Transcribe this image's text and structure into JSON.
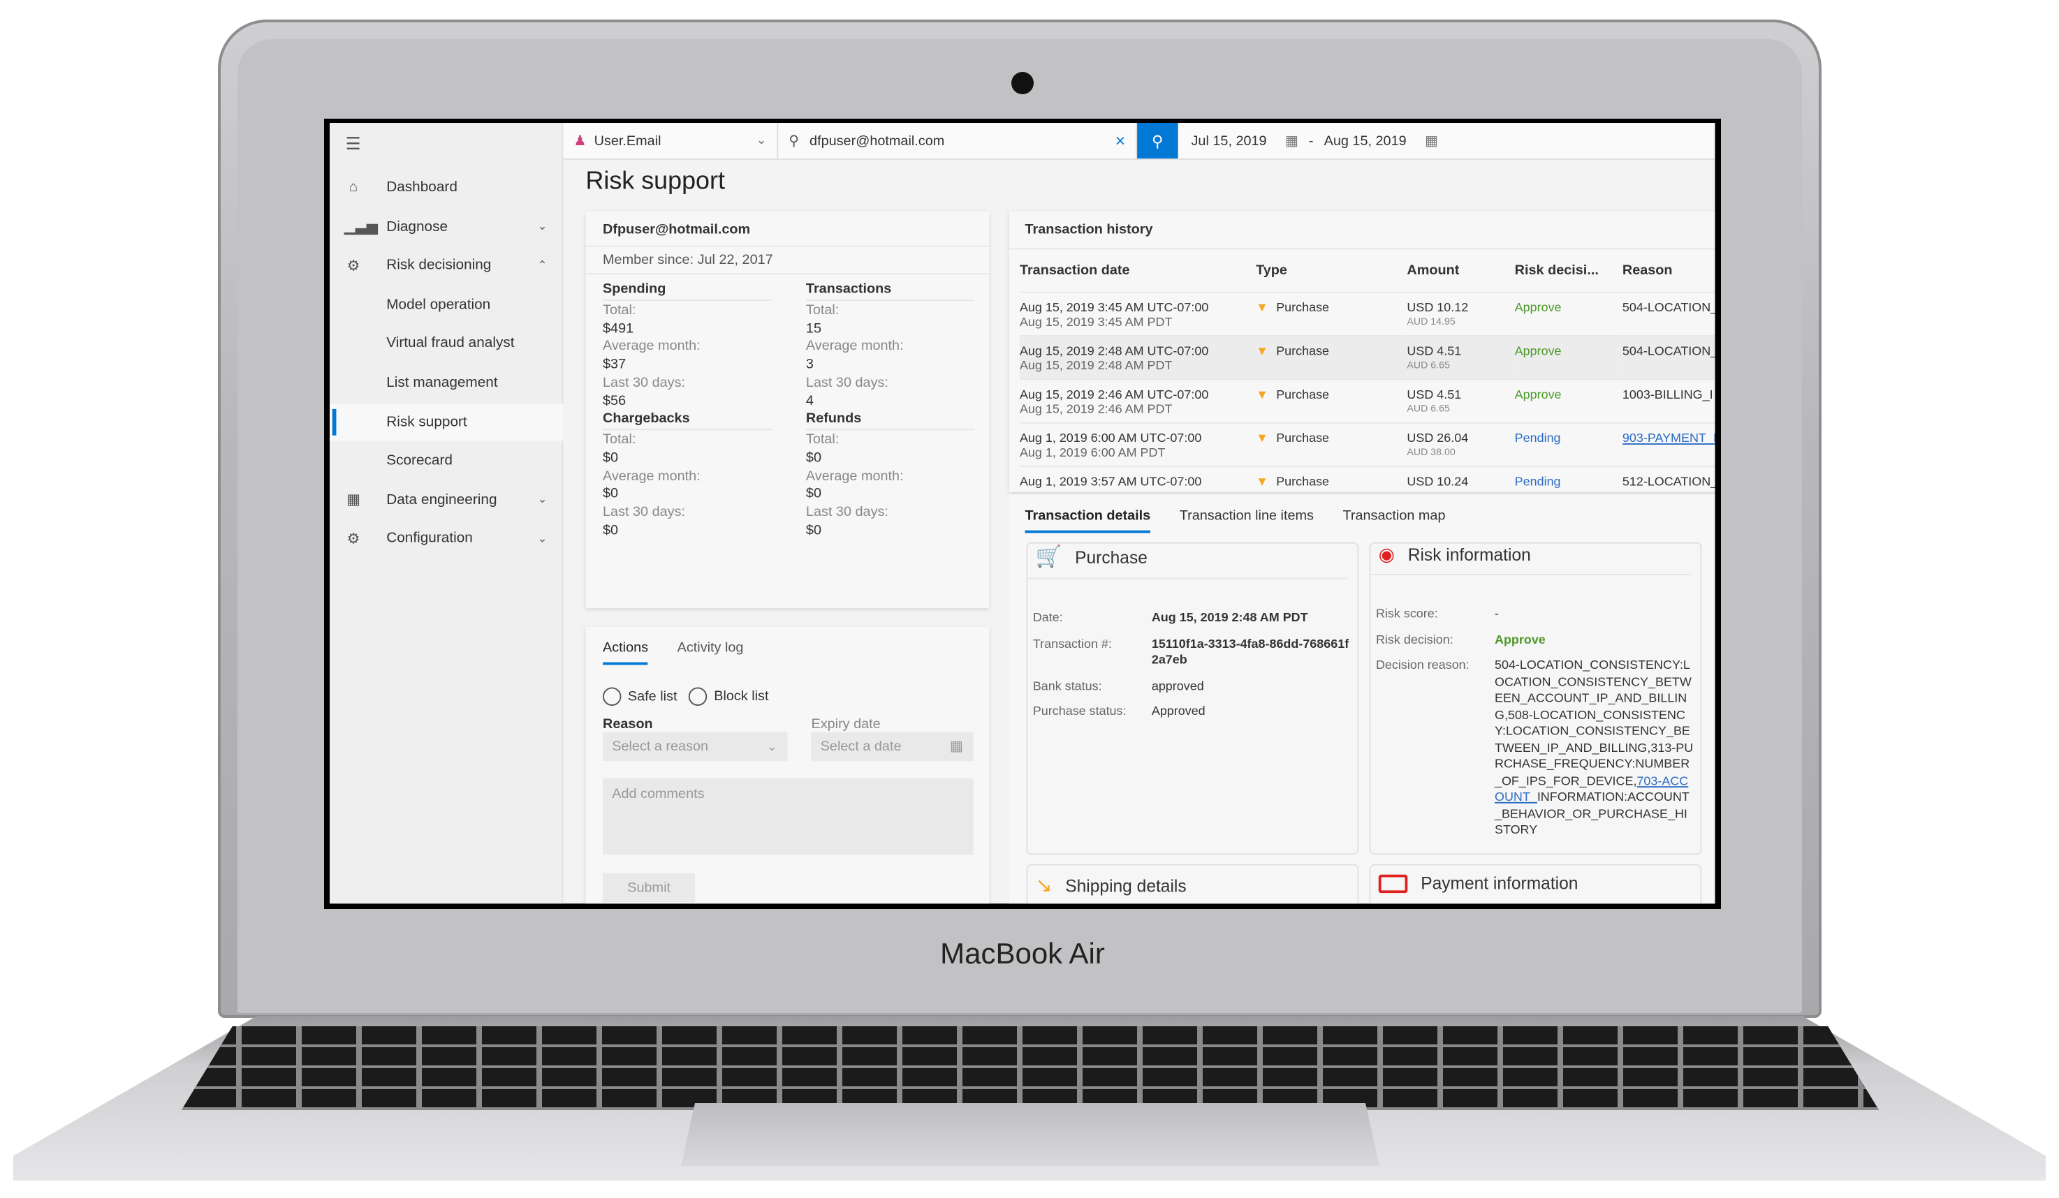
{
  "device": {
    "brand": "MacBook Air"
  },
  "sidebar": {
    "menu_icon": "hamburger-icon",
    "items": [
      {
        "label": "Dashboard",
        "icon": "home-icon"
      },
      {
        "label": "Diagnose",
        "icon": "chart-icon",
        "chevron": "down"
      },
      {
        "label": "Risk decisioning",
        "icon": "gear-flow-icon",
        "chevron": "up"
      },
      {
        "label": "Model operation"
      },
      {
        "label": "Virtual fraud analyst"
      },
      {
        "label": "List management"
      },
      {
        "label": "Risk support",
        "selected": true
      },
      {
        "label": "Scorecard"
      },
      {
        "label": "Data engineering",
        "icon": "table-icon",
        "chevron": "down"
      },
      {
        "label": "Configuration",
        "icon": "settings-icon",
        "chevron": "down"
      }
    ]
  },
  "topbar": {
    "field_select": "User.Email",
    "search_value": "dfpuser@hotmail.com",
    "date_from": "Jul 15, 2019",
    "date_sep": "-",
    "date_to": "Aug 15, 2019"
  },
  "page": {
    "title": "Risk support"
  },
  "profile": {
    "email": "Dfpuser@hotmail.com",
    "member_since": "Member since: Jul 22, 2017",
    "groups": [
      {
        "title": "Spending",
        "rows": [
          [
            "Total:",
            "$491"
          ],
          [
            "Average month:",
            "$37"
          ],
          [
            "Last 30 days:",
            "$56"
          ]
        ]
      },
      {
        "title": "Transactions",
        "rows": [
          [
            "Total:",
            "15"
          ],
          [
            "Average month:",
            "3"
          ],
          [
            "Last 30 days:",
            "4"
          ]
        ]
      },
      {
        "title": "Chargebacks",
        "rows": [
          [
            "Total:",
            "$0"
          ],
          [
            "Average month:",
            "$0"
          ],
          [
            "Last 30 days:",
            "$0"
          ]
        ]
      },
      {
        "title": "Refunds",
        "rows": [
          [
            "Total:",
            "$0"
          ],
          [
            "Average month:",
            "$0"
          ],
          [
            "Last 30 days:",
            "$0"
          ]
        ]
      }
    ]
  },
  "actions": {
    "tabs": [
      "Actions",
      "Activity log"
    ],
    "safe_list": "Safe list",
    "block_list": "Block list",
    "reason_label": "Reason",
    "reason_placeholder": "Select a reason",
    "expiry_label": "Expiry date",
    "expiry_placeholder": "Select a date",
    "comments_placeholder": "Add comments",
    "submit": "Submit"
  },
  "history": {
    "title": "Transaction history",
    "columns": [
      "Transaction date",
      "Type",
      "Amount",
      "Risk decisi...",
      "Reason"
    ],
    "rows": [
      {
        "date": "Aug 15, 2019 3:45 AM UTC-07:00",
        "date_local": "Aug 15, 2019 3:45 AM PDT",
        "type": "Purchase",
        "amount": "USD 10.12",
        "amount_local": "AUD 14.95",
        "decision": "Approve",
        "reason": "504-LOCATION_"
      },
      {
        "date": "Aug 15, 2019 2:48 AM UTC-07:00",
        "date_local": "Aug 15, 2019 2:48 AM PDT",
        "type": "Purchase",
        "amount": "USD 4.51",
        "amount_local": "AUD 6.65",
        "decision": "Approve",
        "reason": "504-LOCATION_",
        "selected": true
      },
      {
        "date": "Aug 15, 2019 2:46 AM UTC-07:00",
        "date_local": "Aug 15, 2019 2:46 AM PDT",
        "type": "Purchase",
        "amount": "USD 4.51",
        "amount_local": "AUD 6.65",
        "decision": "Approve",
        "reason": "1003-BILLING_I"
      },
      {
        "date": "Aug 1, 2019 6:00 AM UTC-07:00",
        "date_local": "Aug 1, 2019 6:00 AM PDT",
        "type": "Purchase",
        "amount": "USD 26.04",
        "amount_local": "AUD 38.00",
        "decision": "Pending",
        "reason": "903-PAYMENT_I",
        "reason_link": true
      },
      {
        "date": "Aug 1, 2019 3:57 AM UTC-07:00",
        "date_local": "",
        "type": "Purchase",
        "amount": "USD 10.24",
        "amount_local": "",
        "decision": "Pending",
        "reason": "512-LOCATION_"
      }
    ]
  },
  "details": {
    "tabs": [
      "Transaction details",
      "Transaction line items",
      "Transaction map"
    ],
    "purchase": {
      "title": "Purchase",
      "rows": [
        [
          "Date:",
          "Aug 15, 2019 2:48 AM PDT"
        ],
        [
          "Transaction #:",
          "15110f1a-3313-4fa8-86dd-768661f2a7eb"
        ],
        [
          "Bank status:",
          "approved"
        ],
        [
          "Purchase status:",
          "Approved"
        ]
      ]
    },
    "risk": {
      "title": "Risk information",
      "score_label": "Risk score:",
      "score": "-",
      "decision_label": "Risk decision:",
      "decision": "Approve",
      "reason_label": "Decision reason:",
      "reason_pre": "504-LOCATION_CONSISTENCY:LOCATION_CONSISTENCY_BETWEEN_ACCOUNT_IP_AND_BILLING,508-LOCATION_CONSISTENCY:LOCATION_CONSISTENCY_BETWEEN_IP_AND_BILLING,313-PURCHASE_FREQUENCY:NUMBER_OF_IPS_FOR_DEVICE,",
      "reason_link": "703-ACCOUNT_",
      "reason_post": "INFORMATION:ACCOUNT_BEHAVIOR_OR_PURCHASE_HISTORY"
    },
    "shipping": {
      "title": "Shipping details"
    },
    "payment": {
      "title": "Payment information"
    }
  },
  "colors": {
    "accent": "#0078d4",
    "approve": "#4c9a2a",
    "pending": "#2b6cc4",
    "cart": "#f5a623",
    "risk": "#e02020"
  }
}
